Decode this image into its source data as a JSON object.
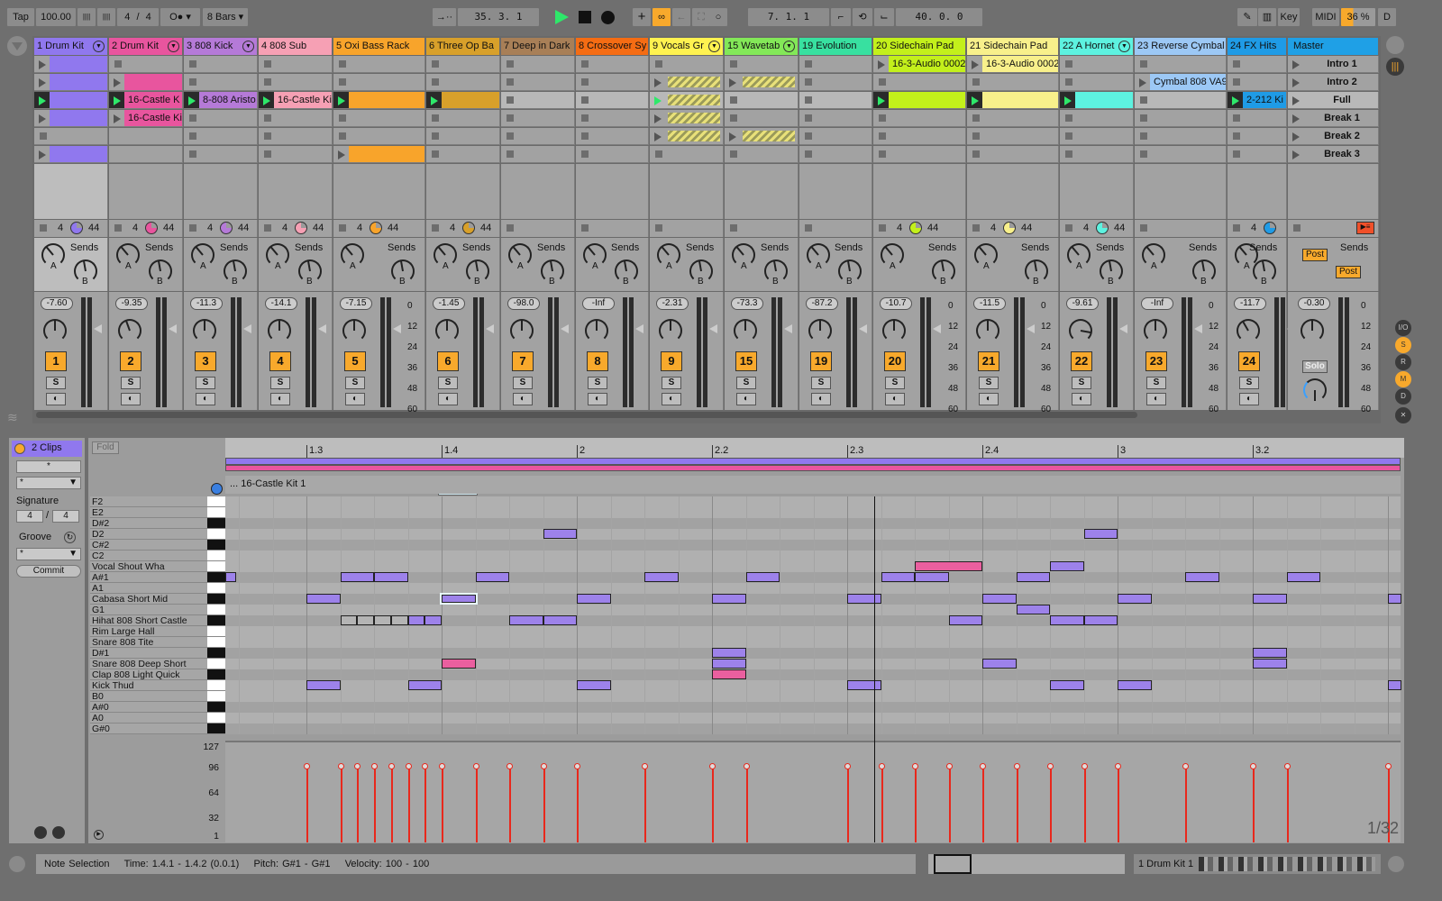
{
  "transport": {
    "tap": "Tap",
    "tempo": "100.00",
    "nudge_down": "||||",
    "nudge_up": "||||",
    "sig_num": "4",
    "sig_sep": "/",
    "sig_den": "4",
    "metronome": "O●",
    "quantize": "8 Bars",
    "follow": "→··",
    "position": "35.  3.  1",
    "add": "+",
    "loop_start": "7.  1.  1",
    "loop_length": "40.  0.  0",
    "key": "Key",
    "midi": "MIDI",
    "cpu": "36 %",
    "disk": "D"
  },
  "colors": {
    "accent": "#f8a92c",
    "play": "#2ee86a",
    "note": "#9d82ea",
    "note_pink": "#ea5f9f",
    "velocity": "#e8281c"
  },
  "tracks": [
    {
      "name": "1 Drum Kit",
      "color": "#9078ee",
      "fold": true,
      "volume": "-7.60",
      "number": "1",
      "status": [
        "4",
        "44"
      ],
      "meter": 0.75,
      "clips": [
        "clip",
        "clip",
        "playing",
        "clip",
        "empty",
        "clip"
      ],
      "clip_names": [
        "",
        "",
        "",
        "",
        "",
        ""
      ]
    },
    {
      "name": "2 Drum Kit",
      "color": "#e8559e",
      "fold": true,
      "volume": "-9.35",
      "number": "2",
      "status": [
        "4",
        "44"
      ],
      "meter": 0.4,
      "clips": [
        "empty",
        "clip",
        "playing",
        "clip",
        "none",
        "none"
      ],
      "clip_names": [
        "",
        "",
        "16-Castle K",
        "16-Castle Ki",
        "",
        ""
      ]
    },
    {
      "name": "3 808 Kick",
      "color": "#b57ad8",
      "fold": true,
      "volume": "-11.3",
      "number": "3",
      "status": [
        "4",
        "44"
      ],
      "meter": 0,
      "clips": [
        "empty",
        "empty",
        "playing",
        "empty",
        "empty",
        "empty"
      ],
      "clip_names": [
        "",
        "",
        "8-808 Aristo",
        "",
        "",
        ""
      ]
    },
    {
      "name": "4 808 Sub",
      "color": "#f6a0b4",
      "fold": false,
      "volume": "-14.1",
      "number": "4",
      "status": [
        "4",
        "44"
      ],
      "meter": 0,
      "clips": [
        "empty",
        "empty",
        "playing",
        "empty",
        "empty",
        "empty"
      ],
      "clip_names": [
        "",
        "",
        "16-Castle Ki",
        "",
        "",
        ""
      ]
    },
    {
      "name": "5 Oxi Bass Rack",
      "color": "#f8a42b",
      "fold": false,
      "volume": "-7.15",
      "number": "5",
      "status": [
        "4",
        "44"
      ],
      "meter": 0.7,
      "clips": [
        "empty",
        "empty",
        "playing",
        "empty",
        "empty",
        "clip"
      ],
      "clip_names": [
        "",
        "",
        "",
        "",
        "",
        ""
      ]
    },
    {
      "name": "6 Three Op Ba",
      "color": "#d8a02a",
      "fold": false,
      "volume": "-1.45",
      "number": "6",
      "status": [
        "4",
        "44"
      ],
      "meter": 0,
      "clips": [
        "empty",
        "empty",
        "playing",
        "empty",
        "empty",
        "empty"
      ],
      "clip_names": [
        "",
        "",
        "",
        "",
        "",
        ""
      ]
    },
    {
      "name": "7 Deep in Dark",
      "color": "#a87f57",
      "fold": false,
      "volume": "-98.0",
      "number": "7",
      "status": [],
      "meter": 0,
      "clips": [
        "empty",
        "empty",
        "empty",
        "empty",
        "empty",
        "empty"
      ],
      "clip_names": [
        "",
        "",
        "",
        "",
        "",
        ""
      ]
    },
    {
      "name": "8 Crossover Sy",
      "color": "#f56c13",
      "fold": false,
      "volume": "-Inf",
      "number": "8",
      "status": [],
      "meter": 0,
      "clips": [
        "empty",
        "empty",
        "empty",
        "empty",
        "empty",
        "empty"
      ],
      "clip_names": [
        "",
        "",
        "",
        "",
        "",
        ""
      ]
    },
    {
      "name": "9 Vocals Gr",
      "color": "#fff250",
      "fold": true,
      "volume": "-2.31",
      "number": "9",
      "status": [],
      "meter": 0.45,
      "clips": [
        "empty",
        "stripe",
        "stripe-playing",
        "stripe",
        "stripe",
        "empty"
      ],
      "clip_names": [
        "",
        "",
        "",
        "",
        "",
        ""
      ]
    },
    {
      "name": "15 Wavetab",
      "color": "#83e858",
      "fold": true,
      "volume": "-73.3",
      "number": "15",
      "status": [],
      "meter": 0,
      "clips": [
        "empty",
        "stripe",
        "empty",
        "empty",
        "stripe",
        "empty"
      ],
      "clip_names": [
        "",
        "",
        "",
        "",
        "",
        ""
      ]
    },
    {
      "name": "19 Evolution",
      "color": "#38e0a0",
      "fold": false,
      "volume": "-87.2",
      "number": "19",
      "status": [],
      "meter": 0,
      "clips": [
        "empty",
        "empty",
        "empty",
        "empty",
        "empty",
        "empty"
      ],
      "clip_names": [
        "",
        "",
        "",
        "",
        "",
        ""
      ]
    },
    {
      "name": "20 Sidechain Pad",
      "color": "#c3f01b",
      "fold": false,
      "volume": "-10.7",
      "number": "20",
      "status": [
        "4",
        "44"
      ],
      "meter": 0.5,
      "clips": [
        "clip",
        "empty",
        "playing",
        "empty",
        "empty",
        "empty"
      ],
      "clip_names": [
        "16-3-Audio 0002",
        "",
        "",
        "",
        "",
        ""
      ]
    },
    {
      "name": "21 Sidechain Pad",
      "color": "#f8f08b",
      "fold": false,
      "volume": "-11.5",
      "number": "21",
      "status": [
        "4",
        "44"
      ],
      "meter": 0.5,
      "clips": [
        "clip",
        "empty",
        "playing",
        "empty",
        "empty",
        "empty"
      ],
      "clip_names": [
        "16-3-Audio 0002",
        "",
        "",
        "",
        "",
        ""
      ]
    },
    {
      "name": "22 A Hornet",
      "color": "#5df2e0",
      "fold": true,
      "volume": "-9.61",
      "number": "22",
      "status": [
        "4",
        "44"
      ],
      "meter": 0,
      "clips": [
        "empty",
        "empty",
        "playing",
        "empty",
        "empty",
        "empty"
      ],
      "clip_names": [
        "",
        "",
        "",
        "",
        "",
        ""
      ]
    },
    {
      "name": "23 Reverse Cymbal",
      "color": "#9cc8f5",
      "fold": false,
      "volume": "-Inf",
      "number": "23",
      "status": [],
      "meter": 0,
      "clips": [
        "empty",
        "clip",
        "empty",
        "empty",
        "empty",
        "empty"
      ],
      "clip_names": [
        "",
        "Cymbal 808 VA9",
        "",
        "",
        "",
        ""
      ]
    },
    {
      "name": "24 FX Hits",
      "color": "#1f9be6",
      "fold": false,
      "volume": "-11.7",
      "number": "24",
      "status": [
        "4"
      ],
      "meter": 0.45,
      "clips": [
        "empty",
        "empty",
        "playing",
        "empty",
        "empty",
        "empty"
      ],
      "clip_names": [
        "",
        "",
        "2-212 Ki",
        "",
        "",
        ""
      ]
    }
  ],
  "master": {
    "name": "Master",
    "color": "#1fa0e6",
    "volume": "-0.30",
    "solo": "Solo",
    "post_a": "Post",
    "post_b": "Post",
    "scenes": [
      "Intro 1",
      "Intro 2",
      "Full",
      "Break 1",
      "Break 2",
      "Break 3"
    ],
    "meter": 0.85
  },
  "mixer": {
    "sends_label": "Sends",
    "send_a": "A",
    "send_b": "B",
    "solo": "S",
    "db_scale": [
      "0",
      "12",
      "24",
      "36",
      "48",
      "60"
    ]
  },
  "side_buttons": [
    "I/O",
    "S",
    "R",
    "M",
    "D"
  ],
  "clip_panel": {
    "title": "2 Clips",
    "name_field": "*",
    "color_select": "*",
    "signature_label": "Signature",
    "sig_num": "4",
    "sig_den": "4",
    "groove_label": "Groove",
    "groove_select": "*",
    "commit": "Commit"
  },
  "piano_roll": {
    "fold": "Fold",
    "clip_name": "... 16-Castle Kit 1",
    "ruler": [
      {
        "beat": 2,
        "label": "1.3"
      },
      {
        "beat": 3,
        "label": "1.4"
      },
      {
        "beat": 4,
        "label": "2"
      },
      {
        "beat": 5,
        "label": "2.2"
      },
      {
        "beat": 6,
        "label": "2.3"
      },
      {
        "beat": 7,
        "label": "2.4"
      },
      {
        "beat": 8,
        "label": "3"
      },
      {
        "beat": 9,
        "label": "3.2"
      }
    ],
    "keys": [
      {
        "label": "F2",
        "black": false
      },
      {
        "label": "E2",
        "black": false
      },
      {
        "label": "D#2",
        "black": true
      },
      {
        "label": "D2",
        "black": false
      },
      {
        "label": "C#2",
        "black": true
      },
      {
        "label": "C2",
        "black": false
      },
      {
        "label": "Vocal Shout Wha",
        "black": false
      },
      {
        "label": "A#1",
        "black": true
      },
      {
        "label": "A1",
        "black": false
      },
      {
        "label": "Cabasa Short Mid",
        "black": true
      },
      {
        "label": "G1",
        "black": false
      },
      {
        "label": "Hihat 808 Short Castle",
        "black": true
      },
      {
        "label": "Rim Large Hall",
        "black": false
      },
      {
        "label": "Snare 808 Tite",
        "black": false
      },
      {
        "label": "D#1",
        "black": true
      },
      {
        "label": "Snare 808 Deep Short",
        "black": false
      },
      {
        "label": "Clap 808 Light Quick",
        "black": true
      },
      {
        "label": "Kick Thud",
        "black": false
      },
      {
        "label": "B0",
        "black": false
      },
      {
        "label": "A#0",
        "black": true
      },
      {
        "label": "A0",
        "black": false
      },
      {
        "label": "G#0",
        "black": true
      }
    ],
    "notes": [
      {
        "pitch": "D2",
        "start": 3.75,
        "length": 0.25
      },
      {
        "pitch": "D2",
        "start": 7.75,
        "length": 0.25
      },
      {
        "pitch": "Vocal Shout Wha",
        "start": 6.5,
        "length": 0.5,
        "color": "pink"
      },
      {
        "pitch": "Vocal Shout Wha",
        "start": 7.5,
        "length": 0.25
      },
      {
        "pitch": "A#1",
        "start": 1.4,
        "length": 0.08
      },
      {
        "pitch": "A#1",
        "start": 2.25,
        "length": 0.25
      },
      {
        "pitch": "A#1",
        "start": 2.5,
        "length": 0.25
      },
      {
        "pitch": "A#1",
        "start": 3.25,
        "length": 0.25
      },
      {
        "pitch": "A#1",
        "start": 4.5,
        "length": 0.25
      },
      {
        "pitch": "A#1",
        "start": 5.25,
        "length": 0.25
      },
      {
        "pitch": "A#1",
        "start": 6.25,
        "length": 0.25
      },
      {
        "pitch": "A#1",
        "start": 6.5,
        "length": 0.25
      },
      {
        "pitch": "A#1",
        "start": 7.25,
        "length": 0.25
      },
      {
        "pitch": "A#1",
        "start": 8.5,
        "length": 0.25
      },
      {
        "pitch": "A#1",
        "start": 9.25,
        "length": 0.25
      },
      {
        "pitch": "Cabasa Short Mid",
        "start": 2,
        "length": 0.25
      },
      {
        "pitch": "Cabasa Short Mid",
        "start": 3,
        "length": 0.25,
        "selected": true
      },
      {
        "pitch": "Cabasa Short Mid",
        "start": 4,
        "length": 0.25
      },
      {
        "pitch": "Cabasa Short Mid",
        "start": 5,
        "length": 0.25
      },
      {
        "pitch": "Cabasa Short Mid",
        "start": 6,
        "length": 0.25
      },
      {
        "pitch": "Cabasa Short Mid",
        "start": 7,
        "length": 0.25
      },
      {
        "pitch": "Cabasa Short Mid",
        "start": 8,
        "length": 0.25
      },
      {
        "pitch": "Cabasa Short Mid",
        "start": 9,
        "length": 0.25
      },
      {
        "pitch": "Cabasa Short Mid",
        "start": 10,
        "length": 0.1
      },
      {
        "pitch": "G1",
        "start": 7.25,
        "length": 0.25
      },
      {
        "pitch": "Hihat 808 Short Castle",
        "start": 2.25,
        "length": 0.125,
        "color": "grey"
      },
      {
        "pitch": "Hihat 808 Short Castle",
        "start": 2.375,
        "length": 0.125,
        "color": "grey"
      },
      {
        "pitch": "Hihat 808 Short Castle",
        "start": 2.5,
        "length": 0.125,
        "color": "grey"
      },
      {
        "pitch": "Hihat 808 Short Castle",
        "start": 2.625,
        "length": 0.125,
        "color": "grey"
      },
      {
        "pitch": "Hihat 808 Short Castle",
        "start": 2.75,
        "length": 0.125
      },
      {
        "pitch": "Hihat 808 Short Castle",
        "start": 2.875,
        "length": 0.125
      },
      {
        "pitch": "Hihat 808 Short Castle",
        "start": 3.5,
        "length": 0.25
      },
      {
        "pitch": "Hihat 808 Short Castle",
        "start": 3.75,
        "length": 0.25
      },
      {
        "pitch": "Hihat 808 Short Castle",
        "start": 6.75,
        "length": 0.25
      },
      {
        "pitch": "Hihat 808 Short Castle",
        "start": 7.5,
        "length": 0.25
      },
      {
        "pitch": "Hihat 808 Short Castle",
        "start": 7.75,
        "length": 0.25
      },
      {
        "pitch": "D#1",
        "start": 5,
        "length": 0.25
      },
      {
        "pitch": "D#1",
        "start": 9,
        "length": 0.25
      },
      {
        "pitch": "Snare 808 Deep Short",
        "start": 3,
        "length": 0.25,
        "color": "pink"
      },
      {
        "pitch": "Snare 808 Deep Short",
        "start": 5,
        "length": 0.25
      },
      {
        "pitch": "Snare 808 Deep Short",
        "start": 7,
        "length": 0.25
      },
      {
        "pitch": "Snare 808 Deep Short",
        "start": 9,
        "length": 0.25
      },
      {
        "pitch": "Clap 808 Light Quick",
        "start": 5,
        "length": 0.25,
        "color": "pink"
      },
      {
        "pitch": "Kick Thud",
        "start": 2,
        "length": 0.25
      },
      {
        "pitch": "Kick Thud",
        "start": 2.75,
        "length": 0.25
      },
      {
        "pitch": "Kick Thud",
        "start": 4,
        "length": 0.25
      },
      {
        "pitch": "Kick Thud",
        "start": 6,
        "length": 0.25
      },
      {
        "pitch": "Kick Thud",
        "start": 7.5,
        "length": 0.25
      },
      {
        "pitch": "Kick Thud",
        "start": 8,
        "length": 0.25
      },
      {
        "pitch": "Kick Thud",
        "start": 10,
        "length": 0.1
      }
    ],
    "velocity": 100,
    "playhead_beat": 6.2,
    "velocity_axis": [
      "127",
      "96",
      "64",
      "32",
      "1"
    ],
    "grid": "1/32"
  },
  "status_bar": {
    "mode": "Note Selection",
    "time": "Time: 1.4.1 - 1.4.2 (0.0.1)",
    "pitch": "Pitch: G#1 - G#1",
    "velocity": "Velocity: 100 - 100",
    "device": "1 Drum Kit 1"
  }
}
